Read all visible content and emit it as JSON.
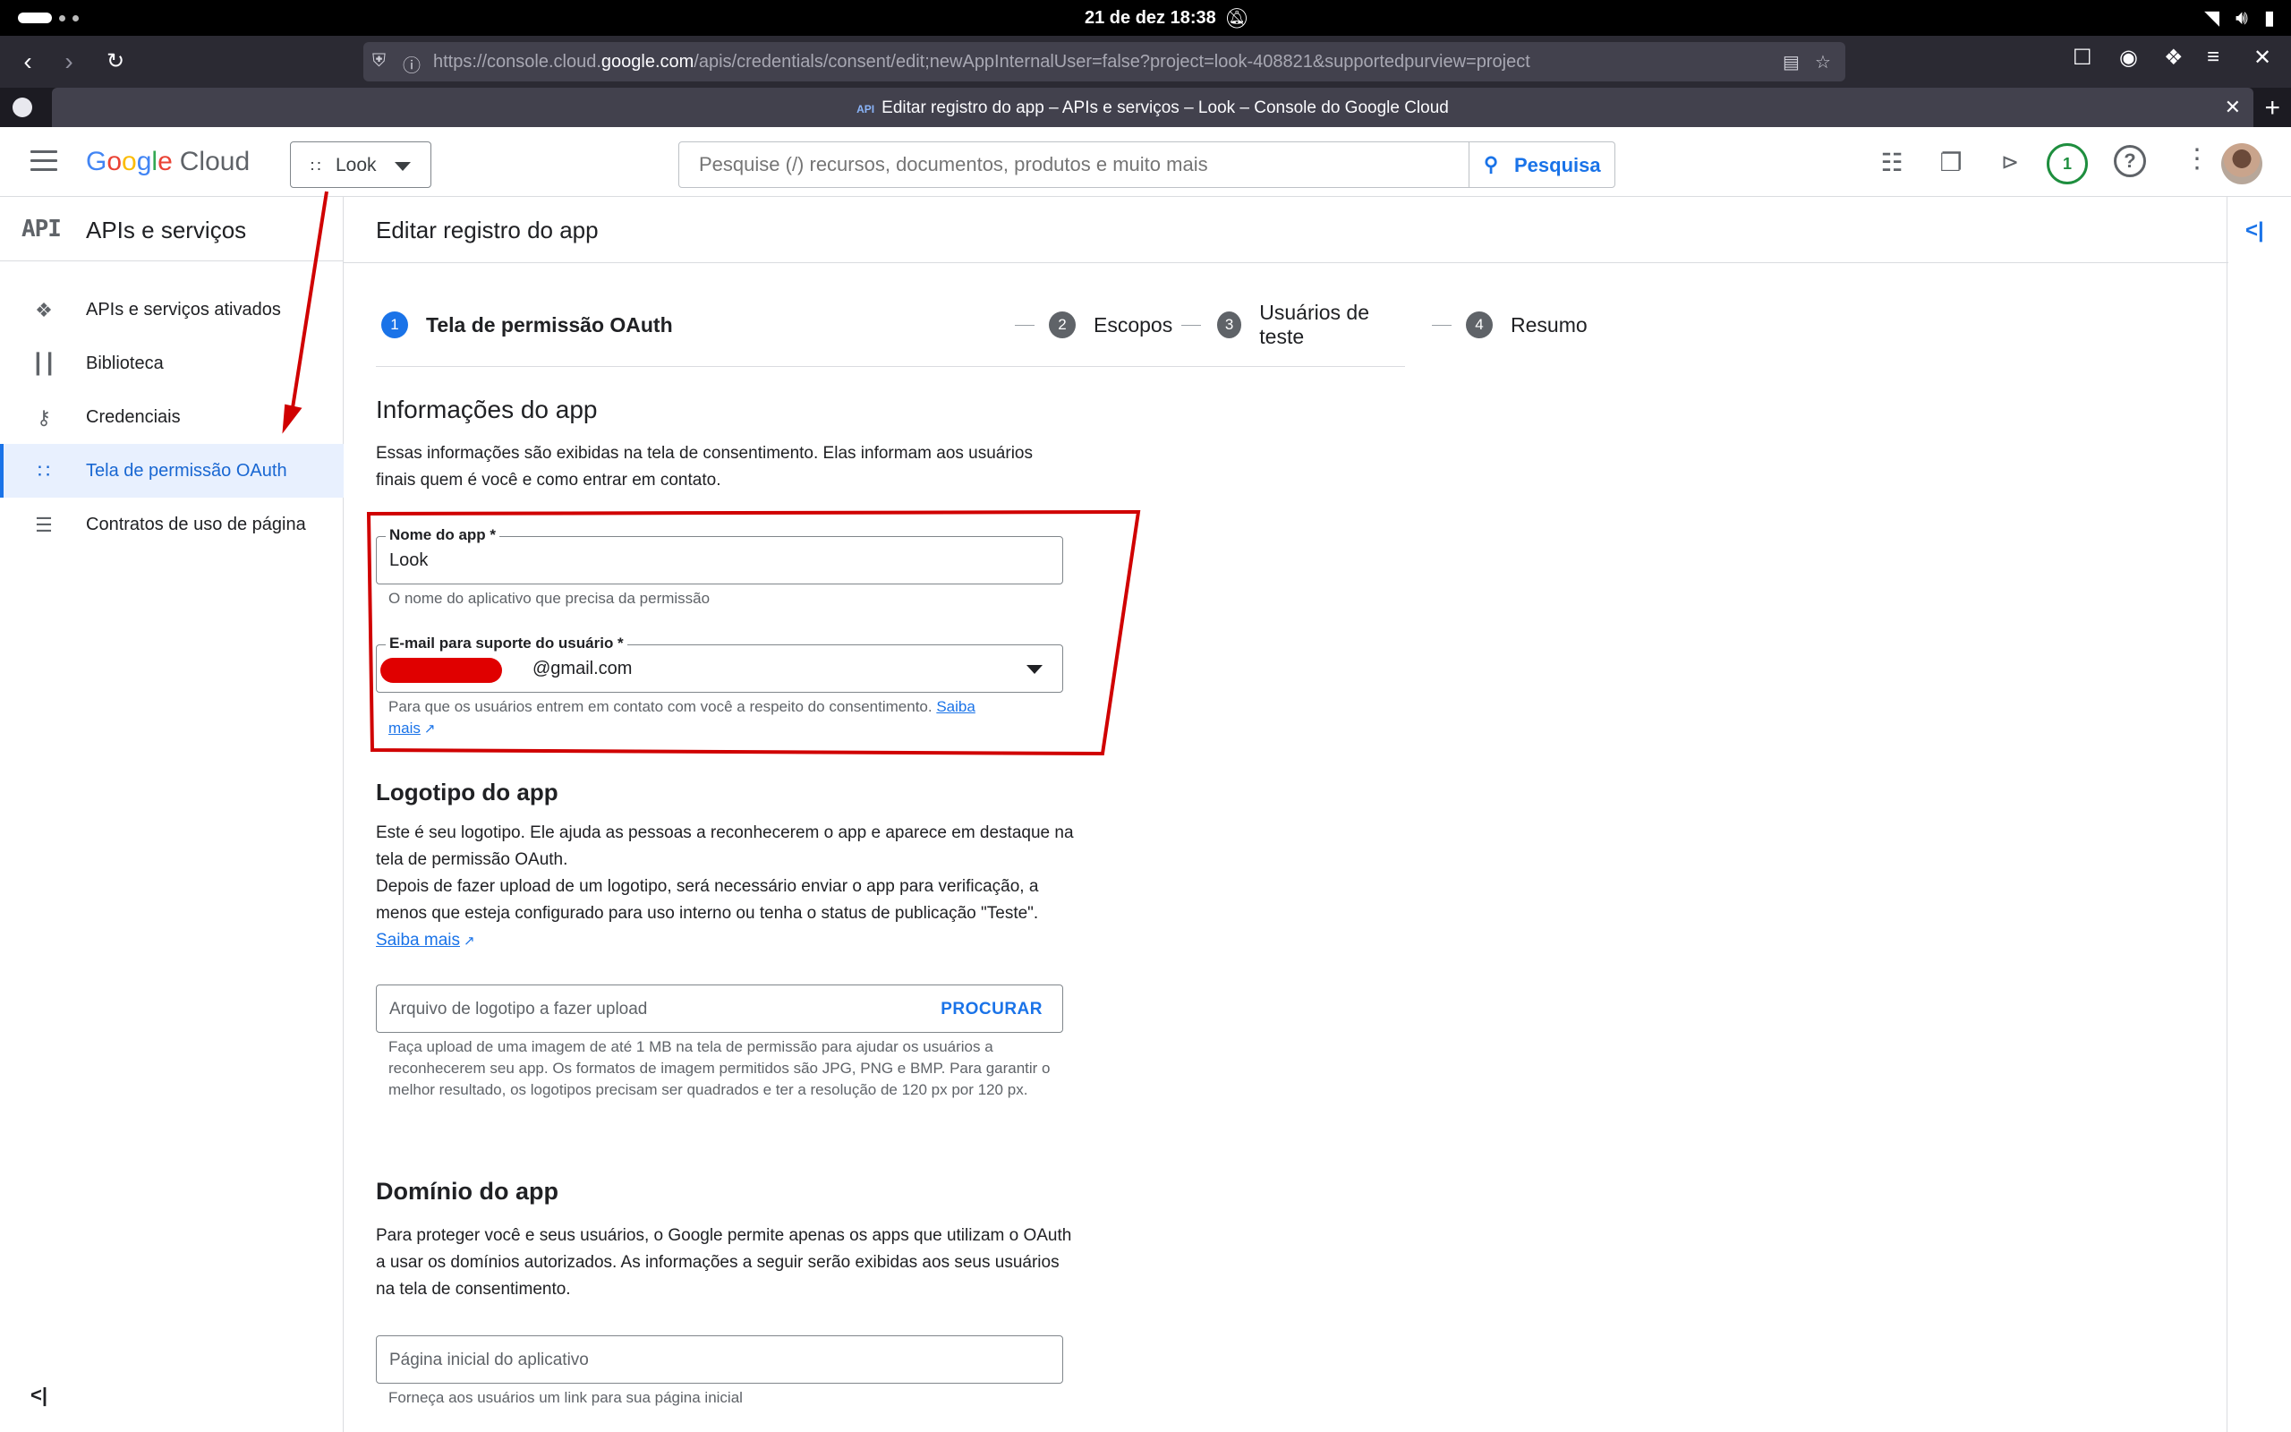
{
  "system": {
    "clock": "21 de dez  18:38"
  },
  "browser": {
    "url_prefix": "https://console.cloud.",
    "url_domain": "google.com",
    "url_suffix": "/apis/credentials/consent/edit;newAppInternalUser=false?project=look-408821&supportedpurview=project",
    "tab_icon_text": "API",
    "tab_title": "Editar registro do app – APIs e serviços – Look – Console do Google Cloud"
  },
  "header": {
    "logo_letters": [
      "G",
      "o",
      "o",
      "g",
      "l",
      "e"
    ],
    "logo_cloud": "Cloud",
    "project_name": "Look",
    "search_placeholder": "Pesquise (/) recursos, documentos, produtos e muito mais",
    "search_button": "Pesquisa",
    "notification_count": "1",
    "help_label": "?"
  },
  "sidebar": {
    "logo_text": "API",
    "title": "APIs e serviços",
    "items": [
      {
        "label": "APIs e serviços ativados",
        "icon": "hub-icon"
      },
      {
        "label": "Biblioteca",
        "icon": "library-icon"
      },
      {
        "label": "Credenciais",
        "icon": "key-icon"
      },
      {
        "label": "Tela de permissão OAuth",
        "icon": "consent-icon",
        "active": true
      },
      {
        "label": "Contratos de uso de página",
        "icon": "settings-list-icon"
      }
    ]
  },
  "main": {
    "page_title": "Editar registro do app",
    "steps": [
      {
        "num": "1",
        "label": "Tela de permissão OAuth",
        "active": true
      },
      {
        "num": "2",
        "label": "Escopos"
      },
      {
        "num": "3",
        "label": "Usuários de teste"
      },
      {
        "num": "4",
        "label": "Resumo"
      }
    ],
    "app_info": {
      "heading": "Informações do app",
      "description": "Essas informações são exibidas na tela de consentimento. Elas informam aos usuários finais quem é você e como entrar em contato.",
      "app_name_label": "Nome do app *",
      "app_name_value": "Look",
      "app_name_hint": "O nome do aplicativo que precisa da permissão",
      "email_label": "E-mail para suporte do usuário *",
      "email_value": "@gmail.com",
      "email_hint": "Para que os usuários entrem em contato com você a respeito do consentimento.",
      "email_hint_link": "Saiba mais"
    },
    "logo": {
      "heading": "Logotipo do app",
      "p1": "Este é seu logotipo. Ele ajuda as pessoas a reconhecerem o app e aparece em destaque na tela de permissão OAuth.",
      "p2": "Depois de fazer upload de um logotipo, será necessário enviar o app para verificação, a menos que esteja configurado para uso interno ou tenha o status de publicação \"Teste\".",
      "link": "Saiba mais",
      "upload_placeholder": "Arquivo de logotipo a fazer upload",
      "browse_button": "PROCURAR",
      "hint": "Faça upload de uma imagem de até 1 MB na tela de permissão para ajudar os usuários a reconhecerem seu app. Os formatos de imagem permitidos são JPG, PNG e BMP. Para garantir o melhor resultado, os logotipos precisam ser quadrados e ter a resolução de 120 px por 120 px."
    },
    "domain": {
      "heading": "Domínio do app",
      "description": "Para proteger você e seus usuários, o Google permite apenas os apps que utilizam o OAuth a usar os domínios autorizados. As informações a seguir serão exibidas aos seus usuários na tela de consentimento.",
      "homepage_placeholder": "Página inicial do aplicativo",
      "homepage_hint": "Forneça aos usuários um link para sua página inicial"
    }
  },
  "colors": {
    "accent": "#1a73e8",
    "annotation": "#d00000",
    "notification": "#1e8e3e"
  }
}
